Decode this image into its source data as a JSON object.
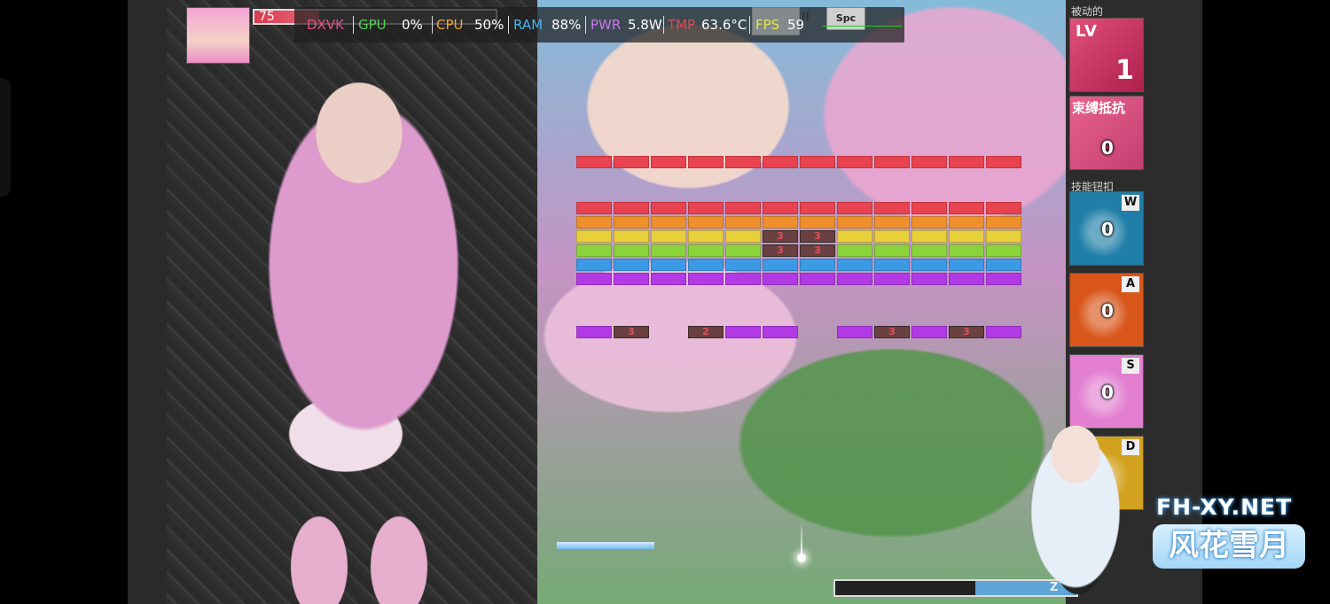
{
  "hud": {
    "api": "DXVK",
    "gpu_label": "GPU",
    "gpu_value": "0%",
    "cpu_label": "CPU",
    "cpu_value": "50%",
    "ram_label": "RAM",
    "ram_value": "88%",
    "pwr_label": "PWR",
    "pwr_value": "5.8W",
    "tmp_label": "TMP",
    "tmp_value": "63.6°C",
    "fps_label": "FPS",
    "fps_value": "59",
    "pause_glyph": "II",
    "spc_label": "Spc",
    "colors": {
      "api": "#e8508c",
      "gpu": "#54d054",
      "cpu": "#f3a23c",
      "ram": "#4ab3f0",
      "pwr": "#c77ae8",
      "tmp": "#e64848",
      "fps": "#e8e84a",
      "value": "#ffffff"
    }
  },
  "player": {
    "hp": "75",
    "hp_fraction": 0.27
  },
  "bricks": {
    "top_row_color": "#e8434f",
    "rows": [
      {
        "color": "#e8434f",
        "hard": []
      },
      {
        "color": "#f0902c",
        "hard": []
      },
      {
        "color": "#e8d03a",
        "hard": [
          {
            "col": 5,
            "hits": "3"
          },
          {
            "col": 6,
            "hits": "3"
          }
        ]
      },
      {
        "color": "#8ad43a",
        "hard": [
          {
            "col": 5,
            "hits": "3"
          },
          {
            "col": 6,
            "hits": "3"
          }
        ]
      },
      {
        "color": "#3c9ae4",
        "hard": []
      },
      {
        "color": "#b13ae4",
        "hard": []
      }
    ],
    "bottom_row": [
      {
        "col": 0,
        "type": "purple"
      },
      {
        "col": 1,
        "type": "hard",
        "hits": "3"
      },
      {
        "col": 3,
        "type": "hard",
        "hits": "2"
      },
      {
        "col": 4,
        "type": "purple"
      },
      {
        "col": 5,
        "type": "purple"
      },
      {
        "col": 7,
        "type": "purple"
      },
      {
        "col": 8,
        "type": "hard",
        "hits": "3"
      },
      {
        "col": 9,
        "type": "purple"
      },
      {
        "col": 10,
        "type": "hard",
        "hits": "3"
      },
      {
        "col": 11,
        "type": "purple"
      }
    ]
  },
  "xp": {
    "fraction": 0.42,
    "label": "Z"
  },
  "sidebar": {
    "passive_label": "被动的",
    "level": {
      "prefix": "LV",
      "value": "1"
    },
    "bind_resist": {
      "title": "束缚抵抗",
      "value": "0"
    },
    "skills_label": "技能钮扣",
    "skills": [
      {
        "key": "W",
        "count": "0",
        "icon": "claw-slash-icon",
        "color": "#1f7fa8"
      },
      {
        "key": "A",
        "count": "0",
        "icon": "fireball-icon",
        "color": "#d9561a"
      },
      {
        "key": "S",
        "count": "0",
        "icon": "heal-cross-icon",
        "color": "#e27fd0"
      },
      {
        "key": "D",
        "count": "",
        "icon": "golden-skill-icon",
        "color": "#d2a11e"
      }
    ]
  },
  "watermark": {
    "url": "FH-XY.NET",
    "name": "风花雪月"
  }
}
